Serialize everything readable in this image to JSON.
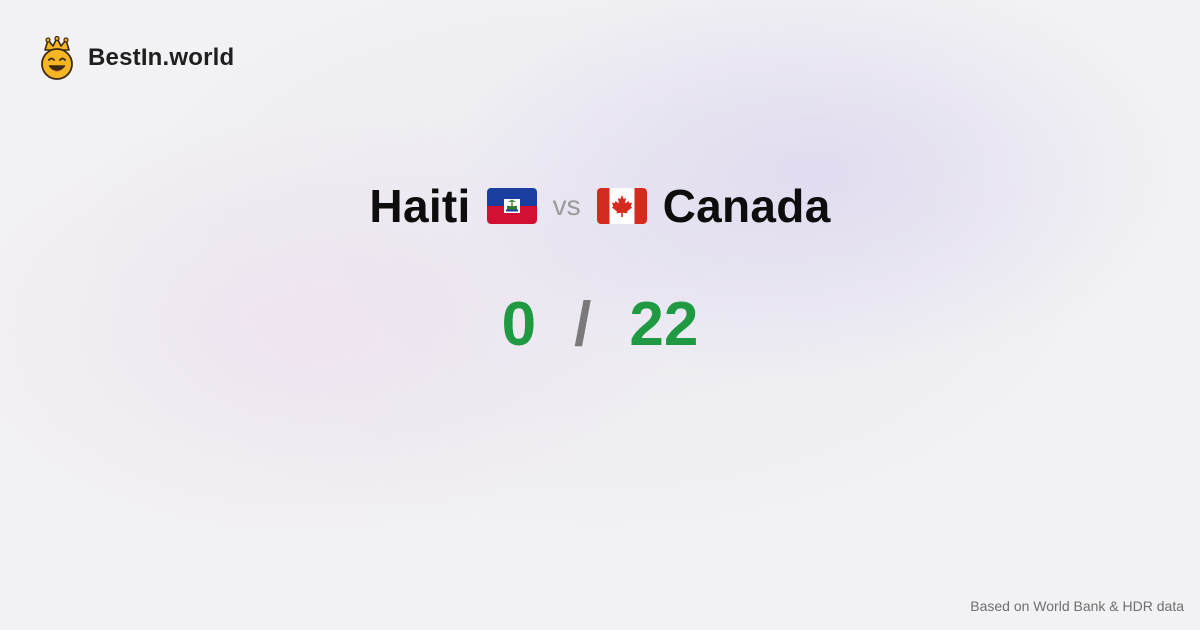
{
  "brand": {
    "name": "BestIn.world",
    "logo_icon": "crown-smiley-icon"
  },
  "comparison": {
    "left_country": "Haiti",
    "left_flag": "haiti-flag-icon",
    "vs_label": "vs",
    "right_country": "Canada",
    "right_flag": "canada-flag-icon"
  },
  "scores": {
    "left_score": "0",
    "separator": "/",
    "right_score": "22",
    "score_color": "#1f9a43",
    "separator_color": "#7a7a7a"
  },
  "footer": {
    "source_text": "Based on World Bank & HDR data"
  }
}
